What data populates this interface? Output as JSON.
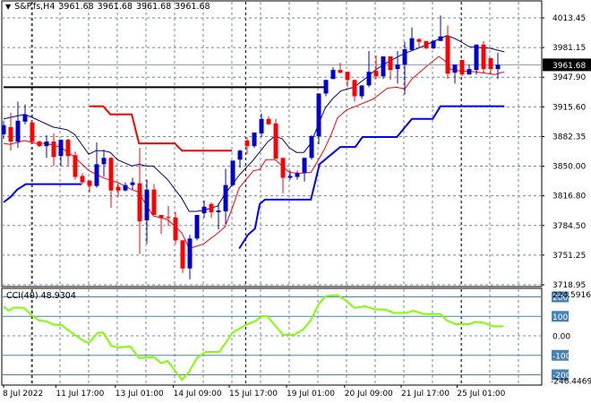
{
  "header": {
    "menu_icon": "triangle-down-icon",
    "symbol": "S&P.fs,H4",
    "open": "3961.68",
    "high": "3961.68",
    "low": "3961.68",
    "close": "3961.68"
  },
  "colors": {
    "bull": "#0000cc",
    "bear": "#ff0000",
    "ma_fast": "#ff0000",
    "ma_slow": "#000080",
    "support": "#0000ff",
    "resistance": "#ff0000",
    "level": "#000000",
    "cci": "#7fff00",
    "cci_level": "#4682b4",
    "grid": "#778899"
  },
  "price_axis": {
    "labels": [
      "4013.45",
      "3981.15",
      "3947.90",
      "3915.60",
      "3882.35",
      "3850.00",
      "3816.80",
      "3784.50",
      "3751.25",
      "3718.95"
    ],
    "range": [
      3718.95,
      4013.45
    ],
    "current_price": "3961.68",
    "current_value": 3961.68
  },
  "time_axis": {
    "labels": [
      "8 Jul 2022",
      "11 Jul 17:00",
      "13 Jul 01:00",
      "14 Jul 09:00",
      "15 Jul 17:00",
      "19 Jul 01:00",
      "20 Jul 09:00",
      "21 Jul 17:00",
      "25 Jul 01:00"
    ],
    "label_bar_index": [
      0,
      7.3,
      15.6,
      23.7,
      31.5,
      39.5,
      47.6,
      55.5,
      63.3
    ],
    "day_separator_bar_index": [
      4,
      33.8,
      63.9
    ]
  },
  "candles": [
    [
      3885,
      3900,
      3880,
      3895
    ],
    [
      3893,
      3909,
      3867,
      3877
    ],
    [
      3877,
      3921,
      3870,
      3900
    ],
    [
      3899,
      3918,
      3896,
      3907
    ],
    [
      3898,
      3900,
      3875,
      3877
    ],
    [
      3877,
      3878,
      3871,
      3872
    ],
    [
      3872,
      3884,
      3859,
      3877
    ],
    [
      3877,
      3886,
      3850,
      3860
    ],
    [
      3861,
      3879,
      3850,
      3879
    ],
    [
      3879,
      3880,
      3850,
      3861
    ],
    [
      3862,
      3866,
      3835,
      3838
    ],
    [
      3839,
      3842,
      3830,
      3832
    ],
    [
      3834,
      3834,
      3821,
      3828
    ],
    [
      3828,
      3876,
      3826,
      3852
    ],
    [
      3852,
      3868,
      3838,
      3859
    ],
    [
      3859,
      3860,
      3804,
      3823
    ],
    [
      3827,
      3832,
      3816,
      3823
    ],
    [
      3823,
      3832,
      3822,
      3829
    ],
    [
      3829,
      3837,
      3824,
      3832
    ],
    [
      3831,
      3870,
      3753,
      3789
    ],
    [
      3790,
      3835,
      3764,
      3824
    ],
    [
      3824,
      3830,
      3796,
      3796
    ],
    [
      3796,
      3796,
      3775,
      3793
    ],
    [
      3794,
      3806,
      3784,
      3793
    ],
    [
      3793,
      3799,
      3764,
      3768
    ],
    [
      3768,
      3768,
      3732,
      3737
    ],
    [
      3737,
      3774,
      3725,
      3770
    ],
    [
      3770,
      3796,
      3768,
      3796
    ],
    [
      3798,
      3812,
      3793,
      3805
    ],
    [
      3808,
      3810,
      3793,
      3799
    ],
    [
      3799,
      3809,
      3780,
      3801
    ],
    [
      3800,
      3847,
      3786,
      3829
    ],
    [
      3829,
      3856,
      3828,
      3856
    ],
    [
      3857,
      3868,
      3848,
      3867
    ],
    [
      3878,
      3882,
      3863,
      3872
    ],
    [
      3872,
      3887,
      3870,
      3887
    ],
    [
      3886,
      3908,
      3882,
      3902
    ],
    [
      3902,
      3905,
      3896,
      3896
    ],
    [
      3897,
      3902,
      3858,
      3858
    ],
    [
      3859,
      3859,
      3820,
      3837
    ],
    [
      3837,
      3845,
      3835,
      3839
    ],
    [
      3838,
      3845,
      3835,
      3842
    ],
    [
      3842,
      3859,
      3833,
      3859
    ],
    [
      3859,
      3884,
      3857,
      3883
    ],
    [
      3883,
      3930,
      3874,
      3930
    ],
    [
      3930,
      3945,
      3927,
      3945
    ],
    [
      3946,
      3959,
      3946,
      3956
    ],
    [
      3956,
      3964,
      3952,
      3953
    ],
    [
      3954,
      3954,
      3937,
      3945
    ],
    [
      3945,
      3945,
      3921,
      3927
    ],
    [
      3927,
      3939,
      3924,
      3939
    ],
    [
      3939,
      3977,
      3937,
      3954
    ],
    [
      3955,
      3972,
      3946,
      3949
    ],
    [
      3949,
      3971,
      3946,
      3971
    ],
    [
      3971,
      3971,
      3945,
      3956
    ],
    [
      3957,
      3977,
      3941,
      3962
    ],
    [
      3962,
      3987,
      3929,
      3979
    ],
    [
      3978,
      4003,
      3977,
      3991
    ],
    [
      3990,
      3991,
      3981,
      3987
    ],
    [
      3988,
      3988,
      3979,
      3980
    ],
    [
      3980,
      3989,
      3979,
      3988
    ],
    [
      3988,
      4016,
      3988,
      3993
    ],
    [
      3994,
      4005,
      3946,
      3952
    ],
    [
      3953,
      3962,
      3941,
      3962
    ],
    [
      3967,
      3967,
      3949,
      3951
    ],
    [
      3951,
      3962,
      3951,
      3957
    ],
    [
      3956,
      3984,
      3951,
      3984
    ],
    [
      3984,
      3988,
      3952,
      3957
    ],
    [
      3969,
      3969,
      3952,
      3957
    ],
    [
      3957,
      3975,
      3946,
      3961.68
    ]
  ],
  "overlays": {
    "ma_slow": [
      [
        0,
        3902
      ],
      [
        2.9,
        3907
      ],
      [
        3.9,
        3904
      ],
      [
        6.9,
        3893
      ],
      [
        8.9,
        3890
      ],
      [
        9.9,
        3885
      ],
      [
        11.9,
        3863
      ],
      [
        12.9,
        3867
      ],
      [
        13.9,
        3867
      ],
      [
        14.9,
        3865
      ],
      [
        15.9,
        3857
      ],
      [
        17.9,
        3850
      ],
      [
        18.9,
        3852
      ],
      [
        19.9,
        3850
      ],
      [
        20.9,
        3850
      ],
      [
        22.9,
        3835
      ],
      [
        24.9,
        3814
      ],
      [
        25.9,
        3800
      ],
      [
        26.9,
        3800
      ],
      [
        27.9,
        3801
      ],
      [
        29.9,
        3806
      ],
      [
        30.9,
        3819
      ],
      [
        32.9,
        3840
      ],
      [
        34.9,
        3857
      ],
      [
        36.9,
        3877
      ],
      [
        37.9,
        3883
      ],
      [
        38.9,
        3880
      ],
      [
        39.9,
        3870
      ],
      [
        40.9,
        3865
      ],
      [
        41.9,
        3865
      ],
      [
        42.9,
        3875
      ],
      [
        43.9,
        3895
      ],
      [
        44.9,
        3914
      ],
      [
        45.9,
        3924
      ],
      [
        47.1,
        3933
      ],
      [
        48.9,
        3937
      ],
      [
        50.9,
        3949
      ],
      [
        51.9,
        3956
      ],
      [
        53.9,
        3966
      ],
      [
        55.9,
        3974
      ],
      [
        57.9,
        3980
      ],
      [
        59.9,
        3987
      ],
      [
        61.9,
        3994
      ],
      [
        62.9,
        3991
      ],
      [
        63.9,
        3987
      ],
      [
        64.9,
        3982
      ],
      [
        65.9,
        3981
      ],
      [
        67.9,
        3980
      ],
      [
        69.9,
        3976
      ]
    ],
    "ma_fast": [
      [
        0,
        3875
      ],
      [
        0.9,
        3874
      ],
      [
        2.9,
        3878
      ],
      [
        4.5,
        3875
      ],
      [
        5.9,
        3875
      ],
      [
        7.9,
        3871
      ],
      [
        9.9,
        3860
      ],
      [
        11.9,
        3845
      ],
      [
        13.9,
        3837
      ],
      [
        15.9,
        3832
      ],
      [
        17.9,
        3824
      ],
      [
        18.9,
        3821
      ],
      [
        19.9,
        3807
      ],
      [
        20.9,
        3795
      ],
      [
        22.9,
        3791
      ],
      [
        24.9,
        3776
      ],
      [
        25.9,
        3759
      ],
      [
        27.9,
        3764
      ],
      [
        29.9,
        3776
      ],
      [
        30.9,
        3783
      ],
      [
        31.9,
        3803
      ],
      [
        32.9,
        3826
      ],
      [
        34.9,
        3845
      ],
      [
        35.75,
        3846
      ],
      [
        36.6,
        3857
      ],
      [
        37.9,
        3857
      ],
      [
        39.9,
        3843
      ],
      [
        41.1,
        3842
      ],
      [
        42.9,
        3843
      ],
      [
        43.6,
        3852
      ],
      [
        44.75,
        3868
      ],
      [
        45.75,
        3885
      ],
      [
        46.6,
        3903
      ],
      [
        47.9,
        3912
      ],
      [
        49.5,
        3917
      ],
      [
        51.6,
        3924
      ],
      [
        53.6,
        3936
      ],
      [
        54.9,
        3937
      ],
      [
        56,
        3935
      ],
      [
        57,
        3946
      ],
      [
        58.6,
        3957
      ],
      [
        60.75,
        3971
      ],
      [
        61.6,
        3966
      ],
      [
        62.4,
        3957
      ],
      [
        63.6,
        3955
      ],
      [
        65.75,
        3954
      ],
      [
        68.6,
        3951
      ],
      [
        69.9,
        3954
      ]
    ],
    "resistance": [
      [
        12,
        3916
      ],
      [
        13.9,
        3916
      ],
      [
        14.9,
        3907
      ],
      [
        17.9,
        3907
      ],
      [
        18.9,
        3875
      ],
      [
        23.9,
        3875
      ],
      [
        24.9,
        3867
      ],
      [
        31.9,
        3867
      ]
    ],
    "support_1": [
      [
        0,
        3810
      ],
      [
        1,
        3816
      ],
      [
        1.9,
        3824
      ],
      [
        3.1,
        3830
      ],
      [
        10.9,
        3830
      ]
    ],
    "support_2": [
      [
        32.9,
        3759
      ],
      [
        34.1,
        3774
      ],
      [
        35.1,
        3781
      ],
      [
        35.75,
        3808
      ],
      [
        36.5,
        3813
      ],
      [
        42.9,
        3813
      ],
      [
        44.1,
        3852
      ],
      [
        47,
        3871
      ],
      [
        49.1,
        3871
      ],
      [
        50.1,
        3882
      ],
      [
        54.9,
        3882
      ],
      [
        57,
        3902
      ],
      [
        59.9,
        3902
      ],
      [
        61,
        3916
      ],
      [
        69.9,
        3916
      ]
    ],
    "level_line": [
      [
        0,
        3937
      ],
      [
        44.75,
        3937
      ]
    ]
  },
  "cci": {
    "label": "CCI(40)",
    "value": "48.9304",
    "max_label": "224.5916",
    "min_label": "-246.4469",
    "level_labels": [
      "200",
      "100",
      "0.00",
      "-100",
      "-200"
    ],
    "levels": [
      200,
      100,
      0,
      -100,
      -200
    ],
    "range": [
      -246.4469,
      224.5916
    ],
    "points": [
      [
        0,
        151
      ],
      [
        0.7,
        129
      ],
      [
        1.4,
        144
      ],
      [
        2.85,
        144
      ],
      [
        3.8,
        109
      ],
      [
        5,
        78
      ],
      [
        6,
        75
      ],
      [
        6.9,
        58
      ],
      [
        8.1,
        55
      ],
      [
        9.5,
        17
      ],
      [
        11,
        -22
      ],
      [
        11.9,
        -37
      ],
      [
        13.1,
        14
      ],
      [
        13.9,
        17
      ],
      [
        15.05,
        -52
      ],
      [
        16,
        -60
      ],
      [
        17.7,
        -55
      ],
      [
        18.9,
        -114
      ],
      [
        21,
        -109
      ],
      [
        22,
        -140
      ],
      [
        22.9,
        -129
      ],
      [
        24.9,
        -226
      ],
      [
        25.8,
        -190
      ],
      [
        27,
        -114
      ],
      [
        28.2,
        -83
      ],
      [
        30.1,
        -83
      ],
      [
        32,
        17
      ],
      [
        33.9,
        58
      ],
      [
        35.1,
        75
      ],
      [
        36.1,
        101
      ],
      [
        36.8,
        101
      ],
      [
        39,
        5
      ],
      [
        40.6,
        5
      ],
      [
        41.8,
        32
      ],
      [
        42.8,
        75
      ],
      [
        44,
        163
      ],
      [
        45,
        204
      ],
      [
        46.6,
        209
      ],
      [
        47.6,
        186
      ],
      [
        49,
        143
      ],
      [
        50.5,
        152
      ],
      [
        51.9,
        135
      ],
      [
        53.3,
        135
      ],
      [
        54.5,
        117
      ],
      [
        56.2,
        117
      ],
      [
        57.2,
        129
      ],
      [
        58.6,
        112
      ],
      [
        61,
        112
      ],
      [
        61.9,
        78
      ],
      [
        63.1,
        60
      ],
      [
        65,
        60
      ],
      [
        65.8,
        71
      ],
      [
        67,
        68
      ],
      [
        68.2,
        49
      ],
      [
        69.8,
        49
      ]
    ]
  }
}
